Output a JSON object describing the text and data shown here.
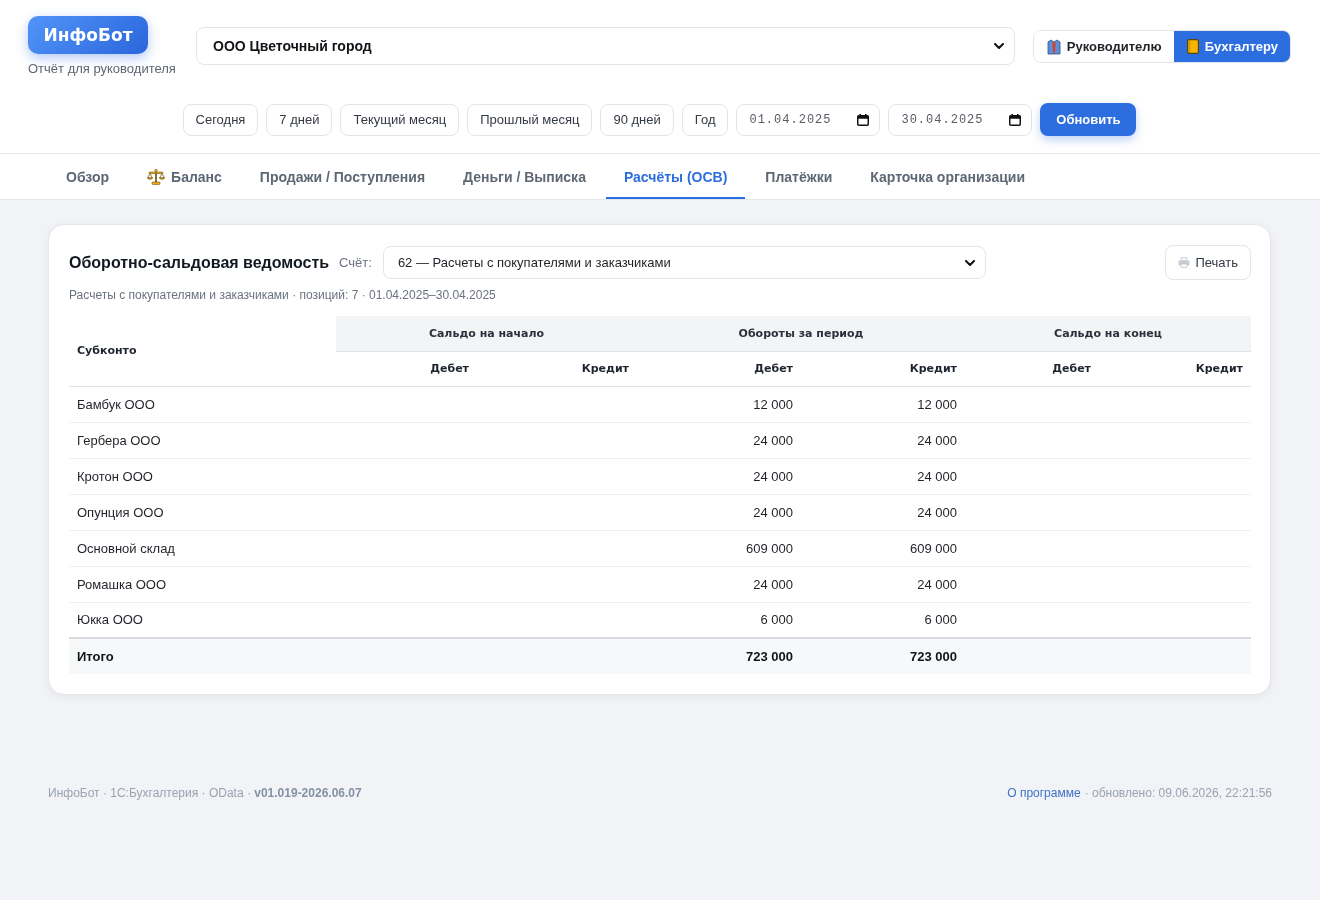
{
  "header": {
    "logo": "ИнфоБот",
    "subtitle": "Отчёт для руководителя",
    "organization": {
      "value": "ООО Цветочный город"
    },
    "roles": [
      {
        "label": "Руководителю",
        "selected": false
      },
      {
        "label": "Бухгалтеру",
        "selected": true
      }
    ]
  },
  "period_bar": {
    "presets": [
      {
        "label": "Сегодня",
        "selected": false
      },
      {
        "label": "7 дней",
        "selected": false
      },
      {
        "label": "Текущий месяц",
        "selected": false
      },
      {
        "label": "Прошлый месяц",
        "selected": false
      },
      {
        "label": "90 дней",
        "selected": false
      },
      {
        "label": "Год",
        "selected": false
      }
    ],
    "date_from": {
      "value": "01.04.2025"
    },
    "date_to": {
      "value": "30.04.2025"
    },
    "refresh_button": "Обновить"
  },
  "tabs": [
    {
      "label": "Обзор",
      "kind": "text",
      "selected": false
    },
    {
      "label": "Баланс",
      "kind": "icon",
      "selected": false
    },
    {
      "label": "Продажи / Поступления",
      "kind": "text",
      "selected": false
    },
    {
      "label": "Деньги / Выписка",
      "kind": "text",
      "selected": false
    },
    {
      "label": "Расчёты (ОСВ)",
      "kind": "text",
      "selected": true
    },
    {
      "label": "Платёжки",
      "kind": "text",
      "selected": false
    },
    {
      "label": "Карточка организации",
      "kind": "text",
      "selected": false
    }
  ],
  "report": {
    "title": "Оборотно-сальдовая ведомость",
    "account_label": "Счёт:",
    "account": {
      "value": "62 — Расчеты с покупателями и заказчиками"
    },
    "print_button": "Печать",
    "summary": "Расчеты с покупателями и заказчиками · позиций: 7 · 01.04.2025–30.04.2025",
    "table": {
      "row_header": "Субконто",
      "groups": [
        {
          "label": "Сальдо на начало",
          "columns": [
            "Дебет",
            "Кредит"
          ]
        },
        {
          "label": "Обороты за период",
          "columns": [
            "Дебет",
            "Кредит"
          ]
        },
        {
          "label": "Сальдо на конец",
          "columns": [
            "Дебет",
            "Кредит"
          ]
        }
      ],
      "rows": [
        {
          "name": "Бамбук ООО",
          "turnover_debit": "12 000",
          "turnover_credit": "12 000"
        },
        {
          "name": "Гербера ООО",
          "turnover_debit": "24 000",
          "turnover_credit": "24 000"
        },
        {
          "name": "Кротон ООО",
          "turnover_debit": "24 000",
          "turnover_credit": "24 000"
        },
        {
          "name": "Опунция ООО",
          "turnover_debit": "24 000",
          "turnover_credit": "24 000"
        },
        {
          "name": "Основной склад",
          "turnover_debit": "609 000",
          "turnover_credit": "609 000"
        },
        {
          "name": "Ромашка ООО",
          "turnover_debit": "24 000",
          "turnover_credit": "24 000"
        },
        {
          "name": "Юкка ООО",
          "turnover_debit": "6 000",
          "turnover_credit": "6 000"
        }
      ],
      "total": {
        "name": "Итого",
        "turnover_debit": "723 000",
        "turnover_credit": "723 000"
      }
    }
  },
  "footer": {
    "info": "ИнфоБот · 1С:Бухгалтерия · OData · **v01.019-2026.06.07**",
    "about_link": "О программе",
    "updated": "· обновлено: 09.06.2026, 22:21:56"
  }
}
